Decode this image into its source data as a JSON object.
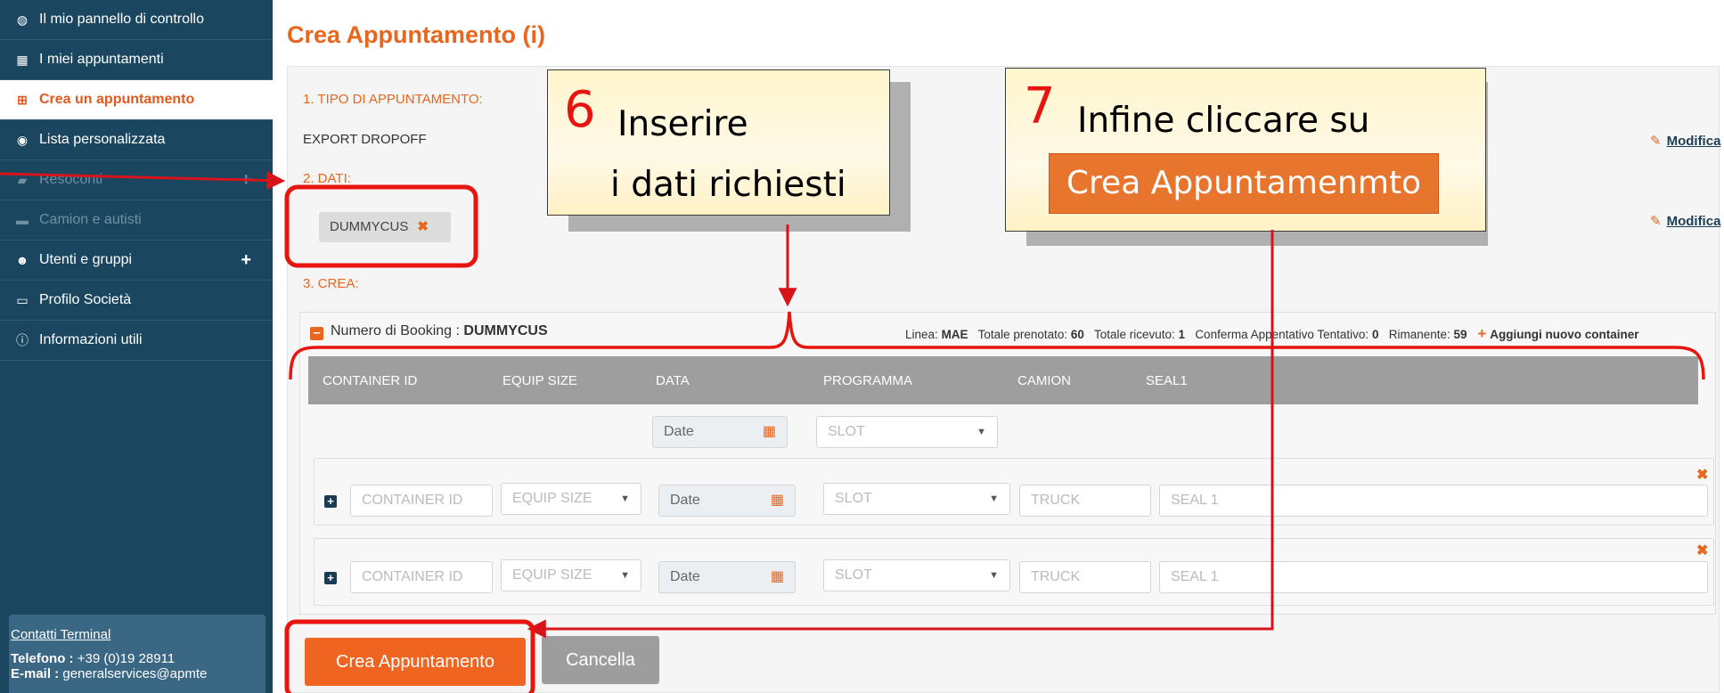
{
  "sidebar": {
    "items": [
      {
        "label": "Il mio pannello di controllo",
        "icon": "dashboard-icon"
      },
      {
        "label": "I miei appuntamenti",
        "icon": "calendar-icon"
      },
      {
        "label": "Crea un appuntamento",
        "icon": "calendar-plus-icon",
        "active": true
      },
      {
        "label": "Lista personalizzata",
        "icon": "eye-icon"
      },
      {
        "label": "Resoconti",
        "icon": "book-icon",
        "disabled": true
      },
      {
        "label": "Camion e autisti",
        "icon": "truck-icon",
        "disabled": true
      },
      {
        "label": "Utenti e gruppi",
        "icon": "users-icon"
      },
      {
        "label": "Profilo Società",
        "icon": "briefcase-icon"
      },
      {
        "label": "Informazioni utili",
        "icon": "info-icon"
      }
    ],
    "contact": {
      "link": "Contatti Terminal",
      "phone_label": "Telefono :",
      "phone": "+39 (0)19 28911",
      "email_label": "E-mail :",
      "email": "generalservices@apmte"
    }
  },
  "main": {
    "title": "Crea Appuntamento (i)",
    "step1": {
      "label": "1. TIPO DI APPUNTAMENTO:",
      "value": "EXPORT DROPOFF",
      "edit": "Modifica"
    },
    "step2": {
      "label": "2. DATI:",
      "tag": "DUMMYCUS",
      "edit": "Modifica"
    },
    "step3": {
      "label": "3. CREA:"
    },
    "booking": {
      "label": "Numero di Booking :",
      "number": "DUMMYCUS",
      "linea_label": "Linea:",
      "linea": "MAE",
      "tot_pren_label": "Totale prenotato:",
      "tot_pren": "60",
      "tot_ric_label": "Totale ricevuto:",
      "tot_ric": "1",
      "conf_label": "Conferma Appentativo Tentativo:",
      "conf": "0",
      "rim_label": "Rimanente:",
      "rim": "59",
      "add": "Aggiungi nuovo container"
    },
    "table": {
      "headers": [
        "CONTAINER ID",
        "EQUIP SIZE",
        "DATA",
        "PROGRAMMA",
        "CAMION",
        "SEAL1"
      ],
      "filter": {
        "date": "Date",
        "slot": "SLOT"
      },
      "rows": [
        {
          "container": "CONTAINER ID",
          "equip": "EQUIP SIZE",
          "date": "Date",
          "slot": "SLOT",
          "truck": "TRUCK",
          "seal": "SEAL 1"
        },
        {
          "container": "CONTAINER ID",
          "equip": "EQUIP SIZE",
          "date": "Date",
          "slot": "SLOT",
          "truck": "TRUCK",
          "seal": "SEAL 1"
        }
      ]
    },
    "buttons": {
      "create": "Crea Appuntamento",
      "cancel": "Cancella"
    }
  },
  "callouts": {
    "six": {
      "num": "6",
      "line1": "Inserire",
      "line2": "i dati richiesti"
    },
    "seven": {
      "num": "7",
      "line1": "Infine  cliccare su",
      "button": "Crea  Appuntamenmto"
    }
  },
  "colors": {
    "sidebar": "#1b4660",
    "accent": "#e8661e",
    "annotation": "#e8140f"
  }
}
